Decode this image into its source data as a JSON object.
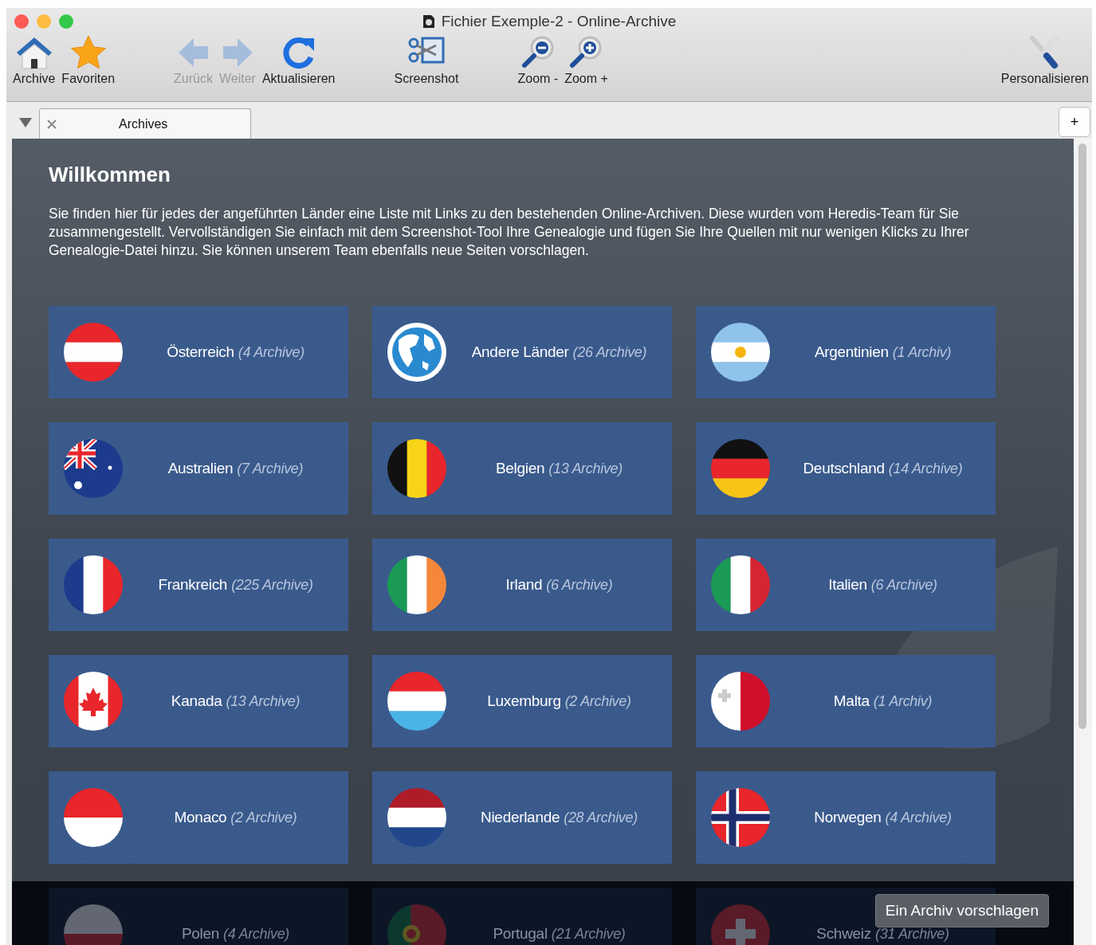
{
  "window": {
    "title": "Fichier Exemple-2 - Online-Archive"
  },
  "toolbar": {
    "groups": [
      [
        {
          "label": "Archive",
          "kind": "house",
          "disabled": false
        },
        {
          "label": "Favoriten",
          "kind": "star",
          "disabled": false
        }
      ],
      [
        {
          "label": "Zurück",
          "kind": "back",
          "disabled": true
        },
        {
          "label": "Weiter",
          "kind": "forward",
          "disabled": true
        },
        {
          "label": "Aktualisieren",
          "kind": "refresh",
          "disabled": false
        }
      ],
      [
        {
          "label": "Screenshot",
          "kind": "screenshot",
          "disabled": false
        }
      ],
      [
        {
          "label": "Zoom -",
          "kind": "zoomout",
          "disabled": false
        },
        {
          "label": "Zoom +",
          "kind": "zoomin",
          "disabled": false
        }
      ],
      [
        {
          "label": "Personalisieren",
          "kind": "tools",
          "disabled": false
        }
      ]
    ]
  },
  "tabs": [
    {
      "label": "Archives",
      "selected": true
    }
  ],
  "new_tab_button": "+",
  "content": {
    "heading": "Willkommen",
    "intro": "Sie finden hier für jedes der angeführten Länder eine Liste mit Links zu den bestehenden Online-Archiven. Diese wurden vom Heredis-Team für Sie zusammengestellt. Vervollständigen Sie einfach mit dem Screenshot-Tool Ihre Genealogie und fügen Sie Ihre Quellen mit nur wenigen Klicks zu Ihrer Genealogie-Datei hinzu. Sie können unserem Team ebenfalls neue Seiten vorschlagen.",
    "countries": [
      {
        "name": "Österreich",
        "count": "(4 Archive)",
        "kind": "austria",
        "dimmed": false
      },
      {
        "name": "Andere Länder",
        "count": "(26 Archive)",
        "kind": "globe",
        "dimmed": false
      },
      {
        "name": "Argentinien",
        "count": "(1 Archiv)",
        "kind": "argentina",
        "dimmed": false
      },
      {
        "name": "Australien",
        "count": "(7 Archive)",
        "kind": "australia",
        "dimmed": false
      },
      {
        "name": "Belgien",
        "count": "(13 Archive)",
        "kind": "belgium",
        "dimmed": false
      },
      {
        "name": "Deutschland",
        "count": "(14 Archive)",
        "kind": "germany",
        "dimmed": false
      },
      {
        "name": "Frankreich",
        "count": "(225 Archive)",
        "kind": "france",
        "dimmed": false
      },
      {
        "name": "Irland",
        "count": "(6 Archive)",
        "kind": "ireland",
        "dimmed": false
      },
      {
        "name": "Italien",
        "count": "(6 Archive)",
        "kind": "italy",
        "dimmed": false
      },
      {
        "name": "Kanada",
        "count": "(13 Archive)",
        "kind": "canada",
        "dimmed": false
      },
      {
        "name": "Luxemburg",
        "count": "(2 Archive)",
        "kind": "luxembourg",
        "dimmed": false
      },
      {
        "name": "Malta",
        "count": "(1 Archiv)",
        "kind": "malta",
        "dimmed": false
      },
      {
        "name": "Monaco",
        "count": "(2 Archive)",
        "kind": "monaco",
        "dimmed": false
      },
      {
        "name": "Niederlande",
        "count": "(28 Archive)",
        "kind": "netherlands",
        "dimmed": false
      },
      {
        "name": "Norwegen",
        "count": "(4 Archive)",
        "kind": "norway",
        "dimmed": false
      },
      {
        "name": "Polen",
        "count": "(4 Archive)",
        "kind": "poland",
        "dimmed": true
      },
      {
        "name": "Portugal",
        "count": "(21 Archive)",
        "kind": "portugal",
        "dimmed": true
      },
      {
        "name": "Schweiz",
        "count": "(31 Archive)",
        "kind": "switzerland",
        "dimmed": true
      }
    ],
    "suggest_button": "Ein Archiv vorschlagen"
  }
}
